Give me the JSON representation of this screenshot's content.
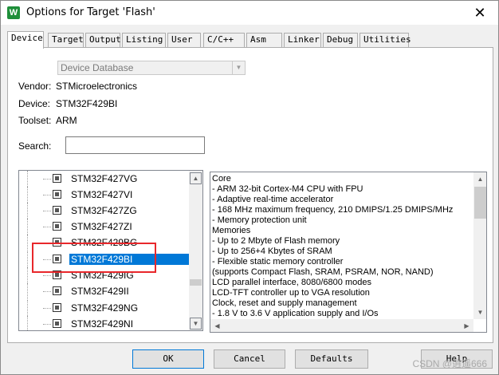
{
  "window": {
    "title": "Options for Target 'Flash'",
    "icon_letter": "W",
    "close_glyph": "✕"
  },
  "tabs": [
    {
      "label": "Device"
    },
    {
      "label": "Target"
    },
    {
      "label": "Output"
    },
    {
      "label": "Listing"
    },
    {
      "label": "User"
    },
    {
      "label": "C/C++"
    },
    {
      "label": "Asm"
    },
    {
      "label": "Linker"
    },
    {
      "label": "Debug"
    },
    {
      "label": "Utilities"
    }
  ],
  "device": {
    "database_select": "Device Database",
    "vendor_label": "Vendor:",
    "vendor": "STMicroelectronics",
    "device_label": "Device:",
    "device": "STM32F429BI",
    "toolset_label": "Toolset:",
    "toolset": "ARM",
    "search_label": "Search:",
    "search_value": ""
  },
  "device_list": {
    "items": [
      {
        "label": "STM32F427VG"
      },
      {
        "label": "STM32F427VI"
      },
      {
        "label": "STM32F427ZG"
      },
      {
        "label": "STM32F427ZI"
      },
      {
        "label": "STM32F429BG"
      },
      {
        "label": "STM32F429BI"
      },
      {
        "label": "STM32F429IG"
      },
      {
        "label": "STM32F429II"
      },
      {
        "label": "STM32F429NG"
      },
      {
        "label": "STM32F429NI"
      }
    ],
    "selected": "STM32F429BI"
  },
  "description": {
    "lines": [
      "Core",
      " - ARM 32-bit Cortex-M4 CPU with FPU",
      " - Adaptive real-time accelerator",
      " - 168 MHz maximum frequency, 210 DMIPS/1.25 DMIPS/MHz",
      " - Memory protection unit",
      "Memories",
      " - Up to 2 Mbyte of Flash memory",
      " - Up to 256+4 Kbytes of SRAM",
      " - Flexible static memory controller",
      "   (supports Compact Flash, SRAM, PSRAM, NOR, NAND)",
      "LCD parallel interface, 8080/6800 modes",
      "LCD-TFT controller up to VGA resolution",
      "Clock, reset and supply management",
      " - 1.8 V to 3.6 V application supply and I/Os"
    ]
  },
  "buttons": {
    "ok": "OK",
    "cancel": "Cancel",
    "defaults": "Defaults",
    "help": "Help"
  },
  "watermark": "CSDN @逍遥666",
  "colors": {
    "selection": "#0078d7",
    "annotation": "#e8272b"
  },
  "icons": {
    "up": "▲",
    "down": "▼",
    "select_arrow": "▼"
  }
}
